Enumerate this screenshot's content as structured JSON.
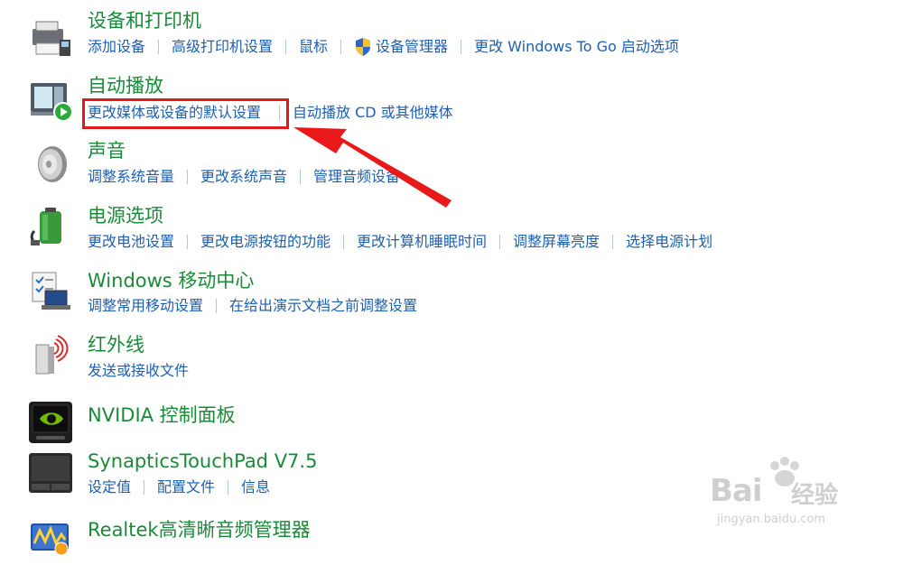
{
  "categories": [
    {
      "title": "设备和打印机",
      "links": [
        "添加设备",
        "高级打印机设置",
        "鼠标",
        "设备管理器",
        "更改 Windows To Go 启动选项"
      ]
    },
    {
      "title": "自动播放",
      "links": [
        "更改媒体或设备的默认设置",
        "自动播放 CD 或其他媒体"
      ]
    },
    {
      "title": "声音",
      "links": [
        "调整系统音量",
        "更改系统声音",
        "管理音频设备"
      ]
    },
    {
      "title": "电源选项",
      "links": [
        "更改电池设置",
        "更改电源按钮的功能",
        "更改计算机睡眠时间",
        "调整屏幕亮度",
        "选择电源计划"
      ]
    },
    {
      "title": "Windows 移动中心",
      "links": [
        "调整常用移动设置",
        "在给出演示文档之前调整设置"
      ]
    },
    {
      "title": "红外线",
      "links": [
        "发送或接收文件"
      ]
    },
    {
      "title": "NVIDIA 控制面板",
      "links": []
    },
    {
      "title": "SynapticsTouchPad V7.5",
      "links": [
        "设定值",
        "配置文件",
        "信息"
      ]
    },
    {
      "title": "Realtek高清晰音频管理器",
      "links": []
    }
  ],
  "watermark": {
    "brand": "Bai",
    "brand2": "经验",
    "url": "jingyan.baidu.com"
  },
  "colors": {
    "title": "#1a8a3a",
    "link": "#1e5fb0",
    "highlight": "#e0191b"
  }
}
